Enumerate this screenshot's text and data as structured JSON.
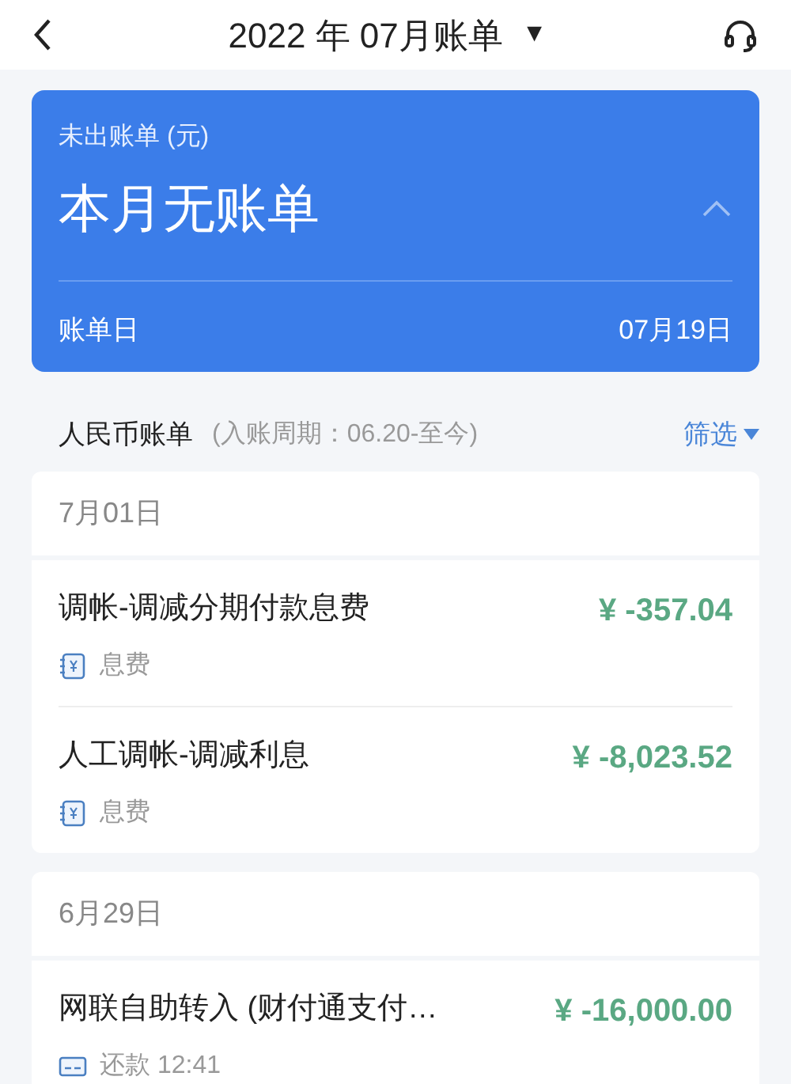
{
  "header": {
    "title": "2022 年 07月账单",
    "dropdown": "▼"
  },
  "bill_card": {
    "label": "未出账单 (元)",
    "status": "本月无账单",
    "expanded": true,
    "date_label": "账单日",
    "date": "07月19日"
  },
  "section": {
    "title": "人民币账单",
    "period": "(入账周期：06.20-至今)",
    "filter": "筛选"
  },
  "groups": [
    {
      "date": "7月01日",
      "items": [
        {
          "kind": "fee",
          "title": "调帐-调减分期付款息费",
          "amount": "¥ -357.04",
          "category": "息费"
        },
        {
          "kind": "fee",
          "title": "人工调帐-调减利息",
          "amount": "¥ -8,023.52",
          "category": "息费"
        }
      ]
    },
    {
      "date": "6月29日",
      "items": [
        {
          "kind": "repayment",
          "title": "网联自助转入 (财付通支付…",
          "amount": "¥ -16,000.00",
          "category": "还款 12:41"
        }
      ]
    }
  ]
}
